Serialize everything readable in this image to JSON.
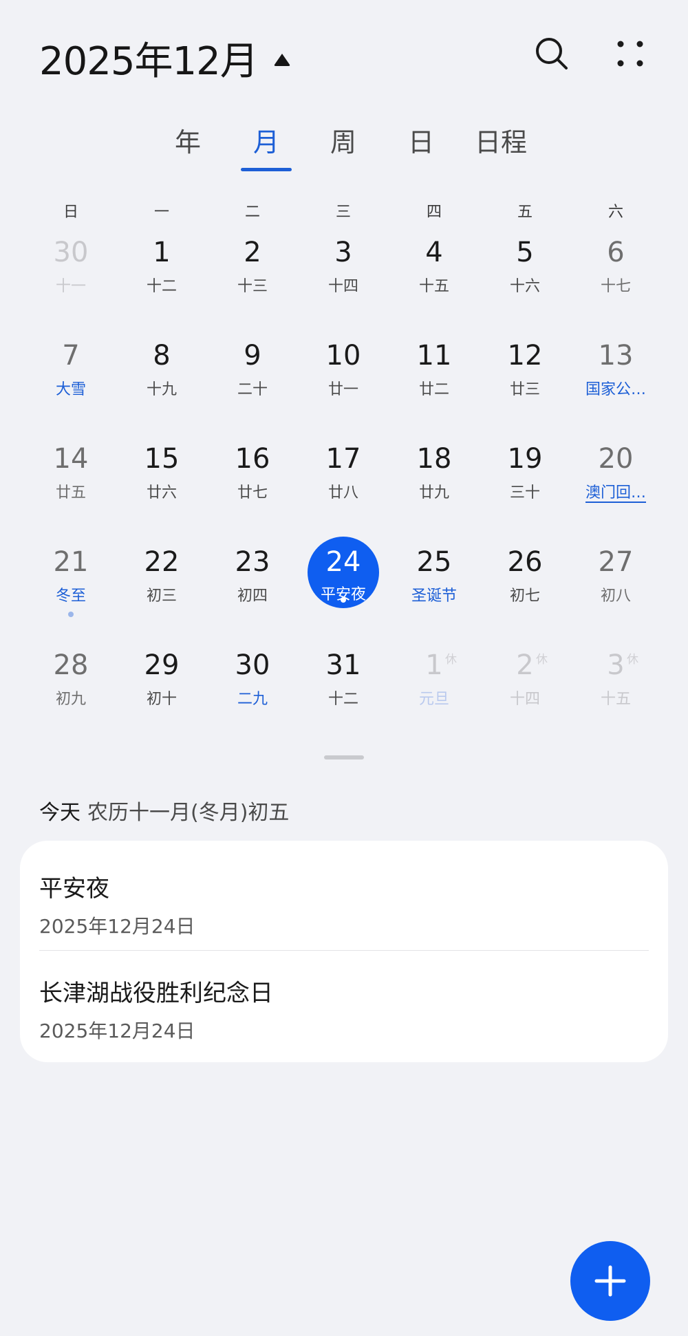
{
  "header": {
    "title": "2025年12月",
    "caret_icon": "caret-up-icon",
    "search_icon": "search-icon",
    "more_icon": "more-dots-icon"
  },
  "tabs": [
    {
      "label": "年",
      "active": false
    },
    {
      "label": "月",
      "active": true
    },
    {
      "label": "周",
      "active": false
    },
    {
      "label": "日",
      "active": false
    },
    {
      "label": "日程",
      "active": false
    }
  ],
  "weekdays": [
    "日",
    "一",
    "二",
    "三",
    "四",
    "五",
    "六"
  ],
  "weeks": [
    [
      {
        "day": "30",
        "lunar": "十一",
        "other": true
      },
      {
        "day": "1",
        "lunar": "十二"
      },
      {
        "day": "2",
        "lunar": "十三"
      },
      {
        "day": "3",
        "lunar": "十四"
      },
      {
        "day": "4",
        "lunar": "十五"
      },
      {
        "day": "5",
        "lunar": "十六"
      },
      {
        "day": "6",
        "lunar": "十七"
      }
    ],
    [
      {
        "day": "7",
        "lunar": "大雪",
        "highlight": true
      },
      {
        "day": "8",
        "lunar": "十九"
      },
      {
        "day": "9",
        "lunar": "二十"
      },
      {
        "day": "10",
        "lunar": "廿一"
      },
      {
        "day": "11",
        "lunar": "廿二"
      },
      {
        "day": "12",
        "lunar": "廿三"
      },
      {
        "day": "13",
        "lunar": "国家公…",
        "highlight": true
      }
    ],
    [
      {
        "day": "14",
        "lunar": "廿五"
      },
      {
        "day": "15",
        "lunar": "廿六"
      },
      {
        "day": "16",
        "lunar": "廿七"
      },
      {
        "day": "17",
        "lunar": "廿八"
      },
      {
        "day": "18",
        "lunar": "廿九"
      },
      {
        "day": "19",
        "lunar": "三十"
      },
      {
        "day": "20",
        "lunar": "澳门回…",
        "highlight": true,
        "underline": true
      }
    ],
    [
      {
        "day": "21",
        "lunar": "冬至",
        "highlight": true,
        "dot": true
      },
      {
        "day": "22",
        "lunar": "初三"
      },
      {
        "day": "23",
        "lunar": "初四"
      },
      {
        "day": "24",
        "lunar": "平安夜",
        "today": true,
        "dot": true
      },
      {
        "day": "25",
        "lunar": "圣诞节",
        "highlight": true
      },
      {
        "day": "26",
        "lunar": "初七"
      },
      {
        "day": "27",
        "lunar": "初八"
      }
    ],
    [
      {
        "day": "28",
        "lunar": "初九"
      },
      {
        "day": "29",
        "lunar": "初十"
      },
      {
        "day": "30",
        "lunar": "二九",
        "highlight": true
      },
      {
        "day": "31",
        "lunar": "十二"
      },
      {
        "day": "1",
        "lunar": "元旦",
        "other": true,
        "highlight": true,
        "tag": "休"
      },
      {
        "day": "2",
        "lunar": "十四",
        "other": true,
        "tag": "休"
      },
      {
        "day": "3",
        "lunar": "十五",
        "other": true,
        "tag": "休"
      }
    ]
  ],
  "today_info": {
    "label": "今天",
    "lunar": "农历十一月(冬月)初五"
  },
  "events": [
    {
      "title": "平安夜",
      "date": "2025年12月24日"
    },
    {
      "title": "长津湖战役胜利纪念日",
      "date": "2025年12月24日"
    }
  ],
  "fab_icon": "plus-icon",
  "colors": {
    "accent": "#0f5ef0",
    "background": "#f1f2f6"
  }
}
